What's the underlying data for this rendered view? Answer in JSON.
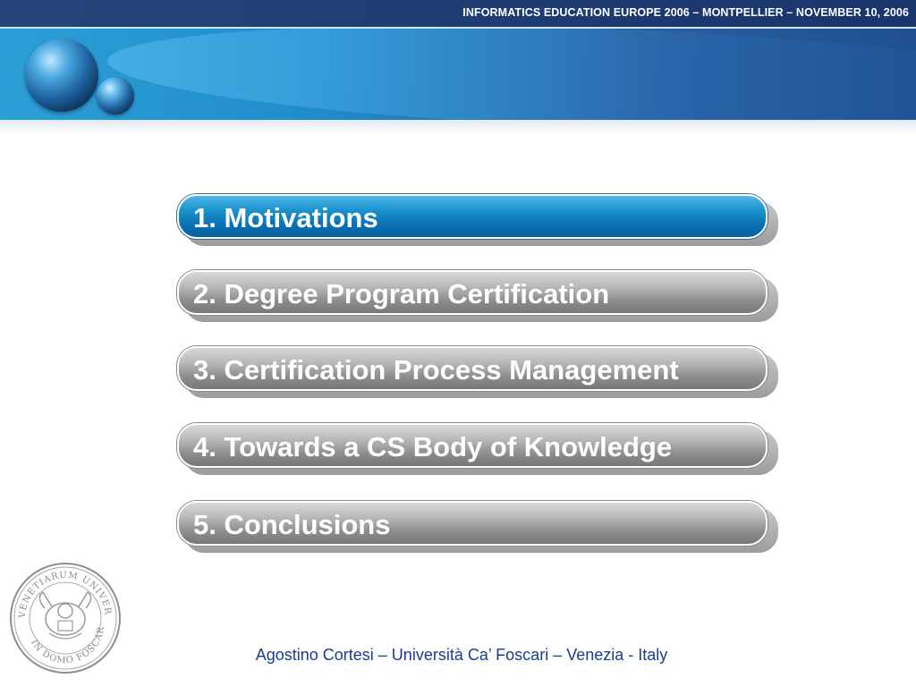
{
  "header": {
    "conference": "INFORMATICS EDUCATION EUROPE 2006 – MONTPELLIER – NOVEMBER 10, 2006"
  },
  "agenda": {
    "items": [
      {
        "label": "1. Motivations",
        "active": true
      },
      {
        "label": "2. Degree Program Certification",
        "active": false
      },
      {
        "label": "3. Certification Process Management",
        "active": false
      },
      {
        "label": "4. Towards a CS Body of Knowledge",
        "active": false
      },
      {
        "label": "5. Conclusions",
        "active": false
      }
    ]
  },
  "footer": {
    "text": "Agostino Cortesi – Università Ca’ Foscari – Venezia - Italy"
  },
  "seal": {
    "text": "VENETIARUM UNIVERSITAS IN DOMO FOSCARI"
  },
  "colors": {
    "active_bar": "#0a70b3",
    "inactive_bar": "#9c9c9c",
    "header_dark": "#1e3d73",
    "footer_text": "#1a3b8f"
  },
  "icons": {
    "logo": "globe-icon",
    "seal": "university-seal-icon"
  }
}
